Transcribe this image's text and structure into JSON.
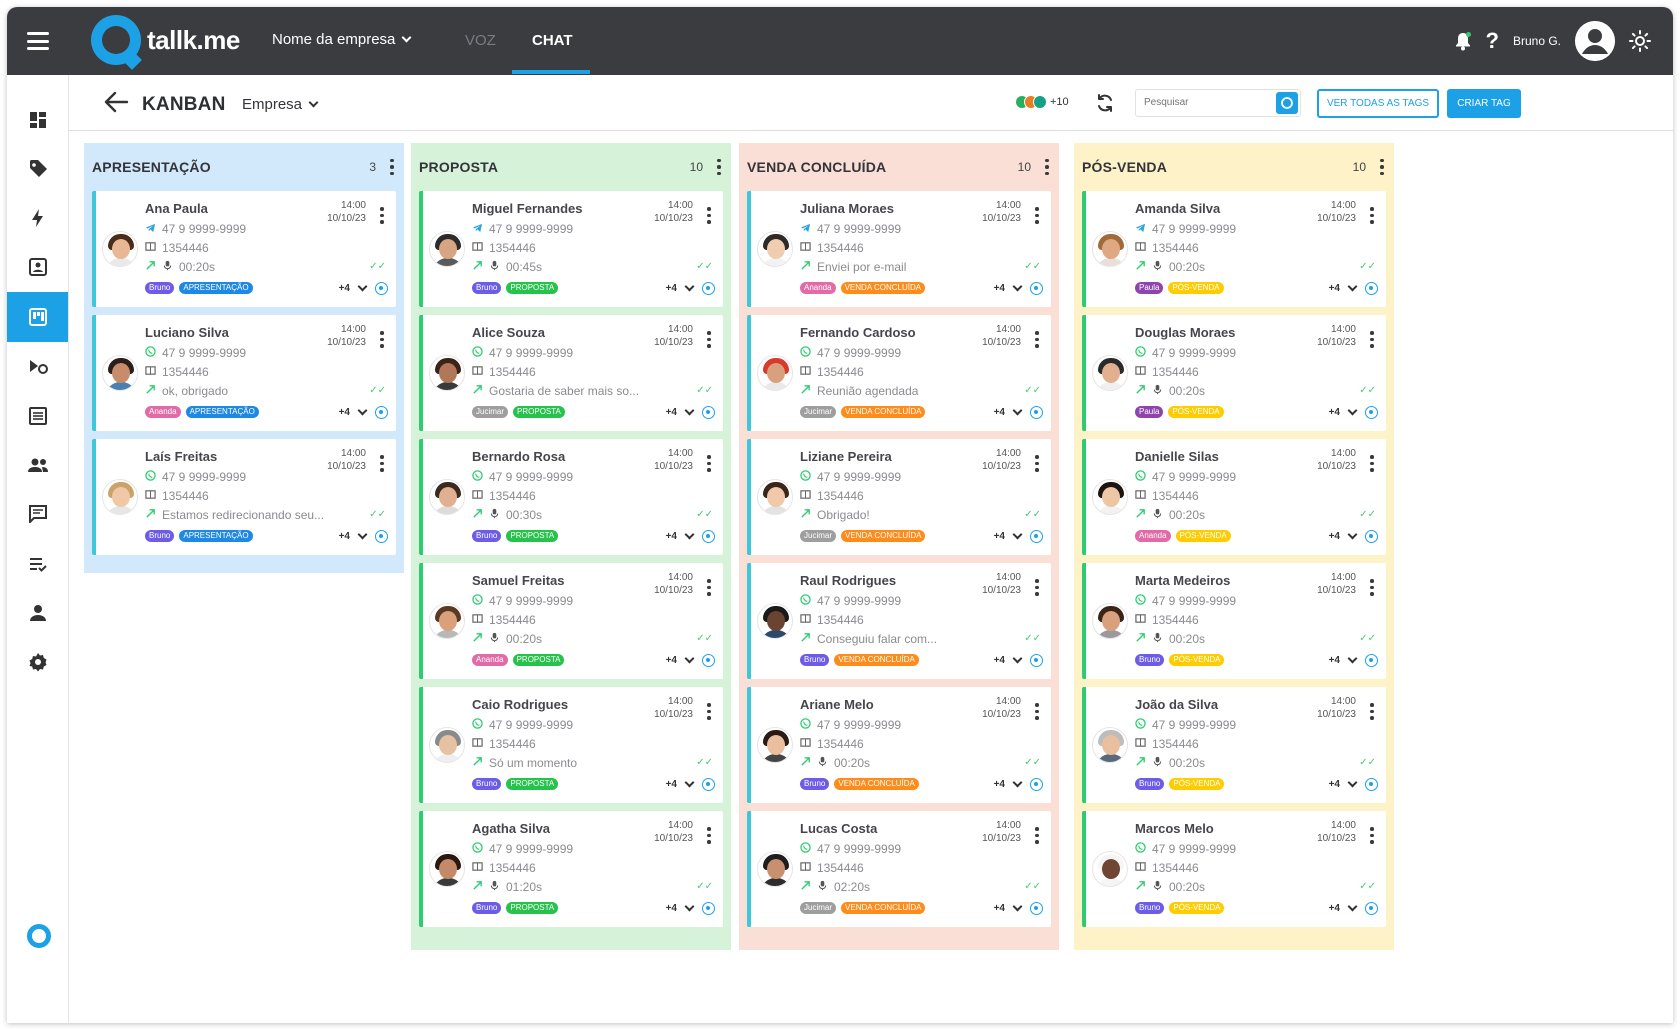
{
  "app": {
    "logo_text": "tallk.me",
    "company": "Nome da empresa",
    "nav_voz": "VOZ",
    "nav_chat": "CHAT",
    "user_name": "Bruno G.",
    "accent": "#1da1e6"
  },
  "sidebar": {
    "icons": [
      "dashboard-icon",
      "tag-icon",
      "bolt-icon",
      "contact-card-icon",
      "kanban-icon",
      "campaign-icon",
      "list-icon",
      "group-icon",
      "chat-icon",
      "playlist-icon",
      "person-icon",
      "gear-icon"
    ],
    "active": "kanban-icon"
  },
  "toolbar": {
    "title": "KANBAN",
    "empresa": "Empresa",
    "agents_more": "+10",
    "search_placeholder": "Pesquisar",
    "ver_todas": "VER TODAS AS TAGS",
    "criar_tag": "CRIAR TAG"
  },
  "columns": [
    {
      "title": "APRESENTAÇÃO",
      "count": "3",
      "bg": "#d2e9fb",
      "bar": "#3ec7d8",
      "cards": [
        {
          "name": "Ana Paula",
          "time": "14:00",
          "date": "10/10/23",
          "channel": "telegram",
          "phone": "47 9 9999-9999",
          "id": "1354446",
          "last": "00:20s",
          "audio": true,
          "agent": "Bruno",
          "agent_color": "#6c5ce7",
          "tag": "APRESENTAÇÃO",
          "tag_color": "#1e88e5",
          "more": "+4",
          "skin": "#e8b796",
          "hair": "#4a2c1a",
          "shirt": "#e9e9e9"
        },
        {
          "name": "Luciano Silva",
          "time": "14:00",
          "date": "10/10/23",
          "channel": "whatsapp",
          "phone": "47 9 9999-9999",
          "id": "1354446",
          "last": "ok, obrigado",
          "audio": false,
          "agent": "Ananda",
          "agent_color": "#e26aa7",
          "tag": "APRESENTAÇÃO",
          "tag_color": "#1e88e5",
          "more": "+4",
          "skin": "#c98c6a",
          "hair": "#2a1f1a",
          "shirt": "#4b7fb0"
        },
        {
          "name": "Laís Freitas",
          "time": "14:00",
          "date": "10/10/23",
          "channel": "whatsapp",
          "phone": "47 9 9999-9999",
          "id": "1354446",
          "last": "Estamos redirecionando seu...",
          "audio": false,
          "agent": "Bruno",
          "agent_color": "#6c5ce7",
          "tag": "APRESENTAÇÃO",
          "tag_color": "#1e88e5",
          "more": "+4",
          "skin": "#f0c8a8",
          "hair": "#c9a46a",
          "shirt": "#e6e6e6"
        }
      ]
    },
    {
      "title": "PROPOSTA",
      "count": "10",
      "bg": "#d6f2d9",
      "bar": "#2ecc71",
      "cards": [
        {
          "name": "Miguel Fernandes",
          "time": "14:00",
          "date": "10/10/23",
          "channel": "telegram",
          "phone": "47 9 9999-9999",
          "id": "1354446",
          "last": "00:45s",
          "audio": true,
          "agent": "Bruno",
          "agent_color": "#6c5ce7",
          "tag": "PROPOSTA",
          "tag_color": "#27c24c",
          "more": "+4",
          "skin": "#d7a582",
          "hair": "#2b2b2b",
          "shirt": "#5a5a5a"
        },
        {
          "name": "Alice Souza",
          "time": "14:00",
          "date": "10/10/23",
          "channel": "whatsapp",
          "phone": "47 9 9999-9999",
          "id": "1354446",
          "last": "Gostaria de saber mais so...",
          "audio": false,
          "agent": "Jucimar",
          "agent_color": "#9e9e9e",
          "tag": "PROPOSTA",
          "tag_color": "#27c24c",
          "more": "+4",
          "skin": "#b07858",
          "hair": "#3a2418",
          "shirt": "#3a3a3a"
        },
        {
          "name": "Bernardo Rosa",
          "time": "14:00",
          "date": "10/10/23",
          "channel": "whatsapp",
          "phone": "47 9 9999-9999",
          "id": "1354446",
          "last": "00:30s",
          "audio": true,
          "agent": "Bruno",
          "agent_color": "#6c5ce7",
          "tag": "PROPOSTA",
          "tag_color": "#27c24c",
          "more": "+4",
          "skin": "#e0b090",
          "hair": "#3b2a20",
          "shirt": "#dcdcdc"
        },
        {
          "name": "Samuel Freitas",
          "time": "14:00",
          "date": "10/10/23",
          "channel": "whatsapp",
          "phone": "47 9 9999-9999",
          "id": "1354446",
          "last": "00:20s",
          "audio": true,
          "agent": "Ananda",
          "agent_color": "#e26aa7",
          "tag": "PROPOSTA",
          "tag_color": "#27c24c",
          "more": "+4",
          "skin": "#d9a07a",
          "hair": "#5a3a22",
          "shirt": "#b8b8b8"
        },
        {
          "name": "Caio Rodrigues",
          "time": "14:00",
          "date": "10/10/23",
          "channel": "whatsapp",
          "phone": "47 9 9999-9999",
          "id": "1354446",
          "last": "Só um momento",
          "audio": false,
          "agent": "Bruno",
          "agent_color": "#6c5ce7",
          "tag": "PROPOSTA",
          "tag_color": "#27c24c",
          "more": "+4",
          "skin": "#e7c2a2",
          "hair": "#8a8a8a",
          "shirt": "#eeeeee"
        },
        {
          "name": "Agatha Silva",
          "time": "14:00",
          "date": "10/10/23",
          "channel": "whatsapp",
          "phone": "47 9 9999-9999",
          "id": "1354446",
          "last": "01:20s",
          "audio": true,
          "agent": "Bruno",
          "agent_color": "#6c5ce7",
          "tag": "PROPOSTA",
          "tag_color": "#27c24c",
          "more": "+4",
          "skin": "#c48a68",
          "hair": "#2a1810",
          "shirt": "#3a3a3a"
        }
      ]
    },
    {
      "title": "VENDA CONCLUÍDA",
      "count": "10",
      "bg": "#fadfd6",
      "bar": "#3ec7d8",
      "cards": [
        {
          "name": "Juliana Moraes",
          "time": "14:00",
          "date": "10/10/23",
          "channel": "telegram",
          "phone": "47 9 9999-9999",
          "id": "1354446",
          "last": "Enviei por e-mail",
          "audio": false,
          "agent": "Ananda",
          "agent_color": "#e26aa7",
          "tag": "VENDA CONCLUÍDA",
          "tag_color": "#ff8c1a",
          "more": "+4",
          "skin": "#f0cdb0",
          "hair": "#2e2a28",
          "shirt": "#f2f2f2"
        },
        {
          "name": "Fernando Cardoso",
          "time": "14:00",
          "date": "10/10/23",
          "channel": "whatsapp",
          "phone": "47 9 9999-9999",
          "id": "1354446",
          "last": "Reunião agendada",
          "audio": false,
          "agent": "Jucimar",
          "agent_color": "#9e9e9e",
          "tag": "VENDA CONCLUÍDA",
          "tag_color": "#ff8c1a",
          "more": "+4",
          "skin": "#d8a07c",
          "hair": "#d93a2b",
          "shirt": "#e9e9e9"
        },
        {
          "name": "Liziane Pereira",
          "time": "14:00",
          "date": "10/10/23",
          "channel": "whatsapp",
          "phone": "47 9 9999-9999",
          "id": "1354446",
          "last": "Obrigado!",
          "audio": false,
          "agent": "Jucimar",
          "agent_color": "#9e9e9e",
          "tag": "VENDA CONCLUÍDA",
          "tag_color": "#ff8c1a",
          "more": "+4",
          "skin": "#f0c8aa",
          "hair": "#3a2618",
          "shirt": "#e3e3e3"
        },
        {
          "name": "Raul Rodrigues",
          "time": "14:00",
          "date": "10/10/23",
          "channel": "whatsapp",
          "phone": "47 9 9999-9999",
          "id": "1354446",
          "last": "Conseguiu falar com...",
          "audio": false,
          "agent": "Bruno",
          "agent_color": "#6c5ce7",
          "tag": "VENDA CONCLUÍDA",
          "tag_color": "#ff8c1a",
          "more": "+4",
          "skin": "#6a4430",
          "hair": "#1a1a1a",
          "shirt": "#2b4a6a"
        },
        {
          "name": "Ariane Melo",
          "time": "14:00",
          "date": "10/10/23",
          "channel": "whatsapp",
          "phone": "47 9 9999-9999",
          "id": "1354446",
          "last": "00:20s",
          "audio": true,
          "agent": "Bruno",
          "agent_color": "#6c5ce7",
          "tag": "VENDA CONCLUÍDA",
          "tag_color": "#ff8c1a",
          "more": "+4",
          "skin": "#e9bfa0",
          "hair": "#2a1a12",
          "shirt": "#444444"
        },
        {
          "name": "Lucas Costa",
          "time": "14:00",
          "date": "10/10/23",
          "channel": "whatsapp",
          "phone": "47 9 9999-9999",
          "id": "1354446",
          "last": "02:20s",
          "audio": true,
          "agent": "Jucimar",
          "agent_color": "#9e9e9e",
          "tag": "VENDA CONCLUÍDA",
          "tag_color": "#ff8c1a",
          "more": "+4",
          "skin": "#c99070",
          "hair": "#1e1e1e",
          "shirt": "#2d2d2d"
        }
      ]
    },
    {
      "title": "PÓS-VENDA",
      "count": "10",
      "bg": "#fdf2c8",
      "bar": "#2ecc71",
      "cards": [
        {
          "name": "Amanda Silva",
          "time": "14:00",
          "date": "10/10/23",
          "channel": "telegram",
          "phone": "47 9 9999-9999",
          "id": "1354446",
          "last": "00:20s",
          "audio": true,
          "agent": "Paula",
          "agent_color": "#8e44ad",
          "tag": "PÓS-VENDA",
          "tag_color": "#ffcc00",
          "more": "+4",
          "skin": "#e0a882",
          "hair": "#a06a3a",
          "shirt": "#e8e0d8"
        },
        {
          "name": "Douglas Moraes",
          "time": "14:00",
          "date": "10/10/23",
          "channel": "whatsapp",
          "phone": "47 9 9999-9999",
          "id": "1354446",
          "last": "00:20s",
          "audio": true,
          "agent": "Paula",
          "agent_color": "#8e44ad",
          "tag": "PÓS-VENDA",
          "tag_color": "#ffcc00",
          "more": "+4",
          "skin": "#e2b090",
          "hair": "#2a2a2a",
          "shirt": "#f0f0f0"
        },
        {
          "name": "Danielle Silas",
          "time": "14:00",
          "date": "10/10/23",
          "channel": "whatsapp",
          "phone": "47 9 9999-9999",
          "id": "1354446",
          "last": "00:20s",
          "audio": true,
          "agent": "Ananda",
          "agent_color": "#e26aa7",
          "tag": "PÓS-VENDA",
          "tag_color": "#ffcc00",
          "more": "+4",
          "skin": "#edc6a6",
          "hair": "#1e1410",
          "shirt": "#f2f2f2"
        },
        {
          "name": "Marta Medeiros",
          "time": "14:00",
          "date": "10/10/23",
          "channel": "whatsapp",
          "phone": "47 9 9999-9999",
          "id": "1354446",
          "last": "00:20s",
          "audio": true,
          "agent": "Bruno",
          "agent_color": "#6c5ce7",
          "tag": "PÓS-VENDA",
          "tag_color": "#ffcc00",
          "more": "+4",
          "skin": "#d9a07e",
          "hair": "#3a2418",
          "shirt": "#9a9a9a"
        },
        {
          "name": "João da Silva",
          "time": "14:00",
          "date": "10/10/23",
          "channel": "whatsapp",
          "phone": "47 9 9999-9999",
          "id": "1354446",
          "last": "00:20s",
          "audio": true,
          "agent": "Bruno",
          "agent_color": "#6c5ce7",
          "tag": "PÓS-VENDA",
          "tag_color": "#ffcc00",
          "more": "+4",
          "skin": "#e8c0a0",
          "hair": "#bdbdbd",
          "shirt": "#5a6a7a"
        },
        {
          "name": "Marcos Melo",
          "time": "14:00",
          "date": "10/10/23",
          "channel": "whatsapp",
          "phone": "47 9 9999-9999",
          "id": "1354446",
          "last": "00:20s",
          "audio": true,
          "agent": "Bruno",
          "agent_color": "#6c5ce7",
          "tag": "PÓS-VENDA",
          "tag_color": "#ffcc00",
          "more": "+4",
          "skin": "#6e4632",
          "hair": "#f5f5f5",
          "shirt": "#f5f5f5"
        }
      ]
    }
  ]
}
